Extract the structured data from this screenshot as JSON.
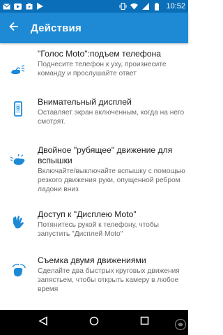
{
  "status_bar": {
    "time": "10:52",
    "icons": [
      "email-icon",
      "youtube-icon",
      "play-store-icon",
      "play-icon",
      "vibrate-icon",
      "wifi-icon",
      "signal-icon",
      "battery-icon"
    ]
  },
  "app_bar": {
    "title": "Действия",
    "back_icon": "arrow-back-icon"
  },
  "items": [
    {
      "title": "\"Голос Moto\":подъем телефона",
      "desc": "Поднесите телефон к уху, произнесите команду и прослушайте ответ",
      "icon": "hand-lift-icon"
    },
    {
      "title": "Внимательный дисплей",
      "desc": "Оставляет экран включенным, когда на него смотрят.",
      "icon": "phone-display-icon"
    },
    {
      "title": "Двойное \"рубящее\" движение для вспышки",
      "desc": "Включайте/выключайте вспышку с помощью резкого движения руки, опущенной ребром ладони вниз",
      "icon": "hand-chop-icon"
    },
    {
      "title": "Доступ к \"Дисплею Moto\"",
      "desc": "Потянитесь рукой к телефону, чтобы запустить \"Дисплей Moto\"",
      "icon": "hand-reach-icon"
    },
    {
      "title": "Съемка двумя движениями",
      "desc": "Сделайте два быстрых круговых движения запястьем, чтобы открыть камеру в любое время",
      "icon": "hand-twist-icon"
    }
  ],
  "nav_bar": {
    "buttons": [
      "back-triangle-icon",
      "home-circle-icon",
      "recents-square-icon"
    ]
  },
  "colors": {
    "status_bar": "#0a6fb8",
    "app_bar": "#1e8ad6",
    "accent_icon": "#1e8ad6",
    "title_text": "#222222",
    "desc_text": "#6b6b6b",
    "nav_bar": "#000000"
  }
}
